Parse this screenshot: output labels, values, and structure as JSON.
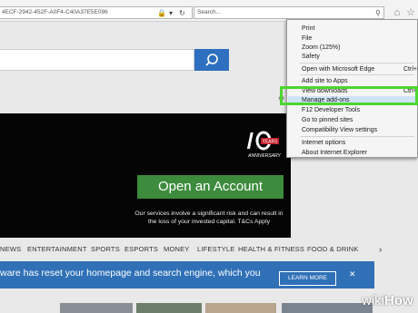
{
  "address_bar": {
    "url": "4ECF-2942-452F-A0F4-C40A37E5E096",
    "search_placeholder": "Search...",
    "refresh_icon": "refresh-icon",
    "lock_icon": "lock-icon",
    "dropdown_icon": "chevron-down-icon"
  },
  "ad": {
    "button_label": "Open an Account",
    "disclaimer_line1": "Our services involve a significant risk and can result in",
    "disclaimer_line2": "the loss of your invested capital. T&Cs Apply",
    "logo_text": "10",
    "logo_years": "YEARS",
    "logo_sub": "ANNIVERSARY"
  },
  "news_nav": {
    "items": [
      "NEWS",
      "ENTERTAINMENT",
      "SPORTS",
      "ESPORTS",
      "MONEY",
      "LIFESTYLE",
      "HEALTH & FITNESS",
      "FOOD & DRINK"
    ],
    "next_icon": "chevron-right-icon"
  },
  "banner": {
    "text": "ware has reset your homepage and search engine, which you",
    "button_label": "LEARN MORE"
  },
  "menu": {
    "items": [
      {
        "label": "Print"
      },
      {
        "label": "File"
      },
      {
        "label": "Zoom (125%)"
      },
      {
        "label": "Safety"
      },
      {
        "label": "Open with Microsoft Edge",
        "shortcut": "Ctrl+Shift+E"
      },
      {
        "label": "Add site to Apps"
      },
      {
        "label": "View downloads",
        "shortcut": "Ctrl+J"
      },
      {
        "label": "Manage add-ons"
      },
      {
        "label": "F12 Developer Tools"
      },
      {
        "label": "Go to pinned sites"
      },
      {
        "label": "Compatibility View settings"
      },
      {
        "label": "Internet options"
      },
      {
        "label": "About Internet Explorer"
      }
    ],
    "highlighted_index": 7
  },
  "watermark": {
    "part1": "wiki",
    "part2": "How"
  },
  "colors": {
    "highlight_box": "#4cd62e",
    "search_button": "#2e6fc0",
    "banner": "#2f70b7",
    "ad_button": "#3d8b3d"
  }
}
